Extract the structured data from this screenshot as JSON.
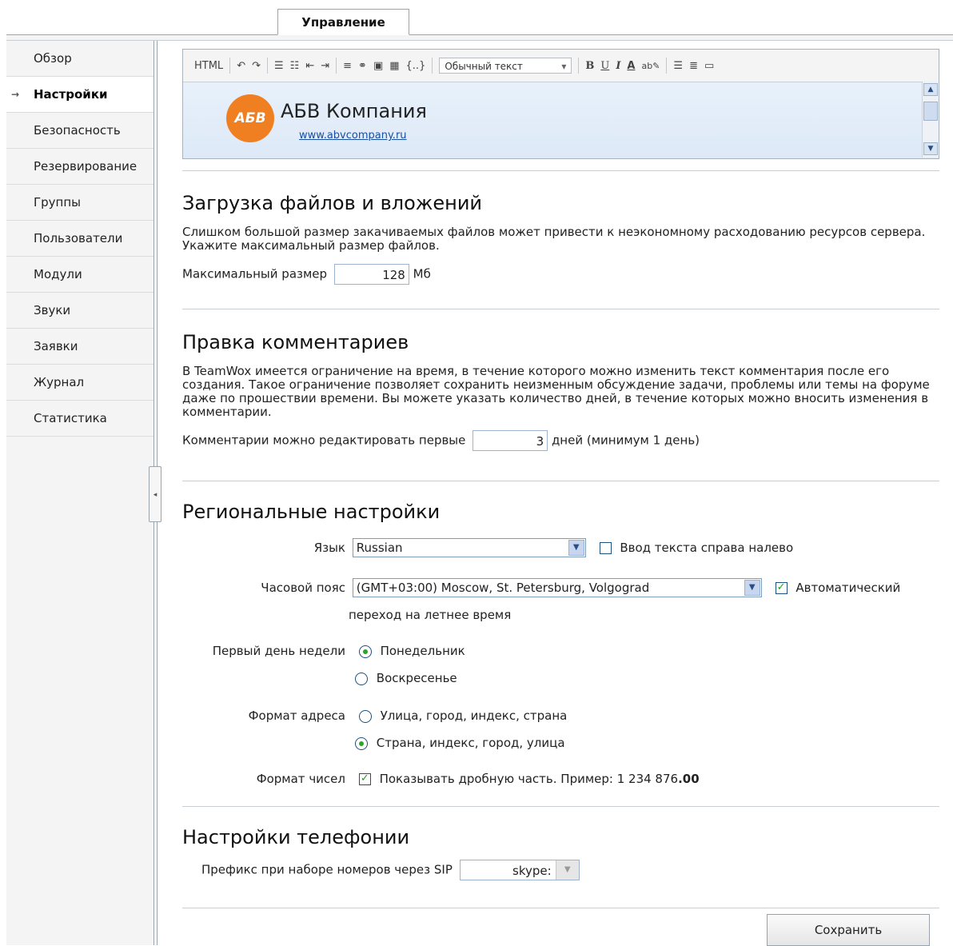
{
  "top_tab": "Управление",
  "sidebar": {
    "items": [
      {
        "label": "Обзор",
        "active": false
      },
      {
        "label": "Настройки",
        "active": true
      },
      {
        "label": "Безопасность",
        "active": false
      },
      {
        "label": "Резервирование",
        "active": false
      },
      {
        "label": "Группы",
        "active": false
      },
      {
        "label": "Пользователи",
        "active": false
      },
      {
        "label": "Модули",
        "active": false
      },
      {
        "label": "Звуки",
        "active": false
      },
      {
        "label": "Заявки",
        "active": false
      },
      {
        "label": "Журнал",
        "active": false
      },
      {
        "label": "Статистика",
        "active": false
      }
    ],
    "active_marker": "→"
  },
  "editor": {
    "html_label": "HTML",
    "style_select": "Обычный текст",
    "insert_template_label": "{..}",
    "company_name": "АБВ Компания",
    "company_url": "www.abvcompany.ru",
    "logo_text": "АБВ",
    "logo_color": "#f07f21"
  },
  "uploads": {
    "title": "Загрузка файлов и вложений",
    "description": "Слишком большой размер закачиваемых файлов может привести к неэкономному расходованию ресурсов сервера. Укажите максимальный размер файлов.",
    "max_size_label": "Максимальный размер",
    "max_size_value": "128",
    "max_size_unit": "Мб"
  },
  "comments": {
    "title": "Правка комментариев",
    "description": "В TeamWox имеется ограничение на время, в течение которого можно изменить текст комментария после его создания. Такое ограничение позволяет сохранить неизменным обсуждение задачи, проблемы или темы на форуме даже по прошествии времени. Вы можете указать количество дней, в течение которых можно вносить изменения в комментарии.",
    "edit_label": "Комментарии можно редактировать первые",
    "edit_value": "3",
    "edit_suffix": "дней (минимум 1 день)"
  },
  "regional": {
    "title": "Региональные настройки",
    "language_label": "Язык",
    "language_value": "Russian",
    "rtl_label": "Ввод текста справа налево",
    "rtl_checked": false,
    "timezone_label": "Часовой пояс",
    "timezone_value": "(GMT+03:00) Moscow, St. Petersburg, Volgograd",
    "dst_label_1": "Автоматический",
    "dst_label_2": "переход на летнее время",
    "dst_checked": true,
    "first_day_label": "Первый день недели",
    "first_day_options": [
      "Понедельник",
      "Воскресенье"
    ],
    "first_day_selected": "Понедельник",
    "address_label": "Формат адреса",
    "address_options": [
      "Улица, город, индекс, страна",
      "Страна, индекс, город, улица"
    ],
    "address_selected": "Страна, индекс, город, улица",
    "number_label": "Формат чисел",
    "number_text": "Показывать дробную часть. Пример: 1 234 876",
    "number_fraction": ".00",
    "number_checked": true
  },
  "telephony": {
    "title": "Настройки телефонии",
    "sip_label": "Префикс при наборе номеров через SIP",
    "sip_value": "skype:"
  },
  "save_label": "Сохранить",
  "colors": {
    "check_mark": "#1f9e1f",
    "link": "#1a4fa0"
  }
}
